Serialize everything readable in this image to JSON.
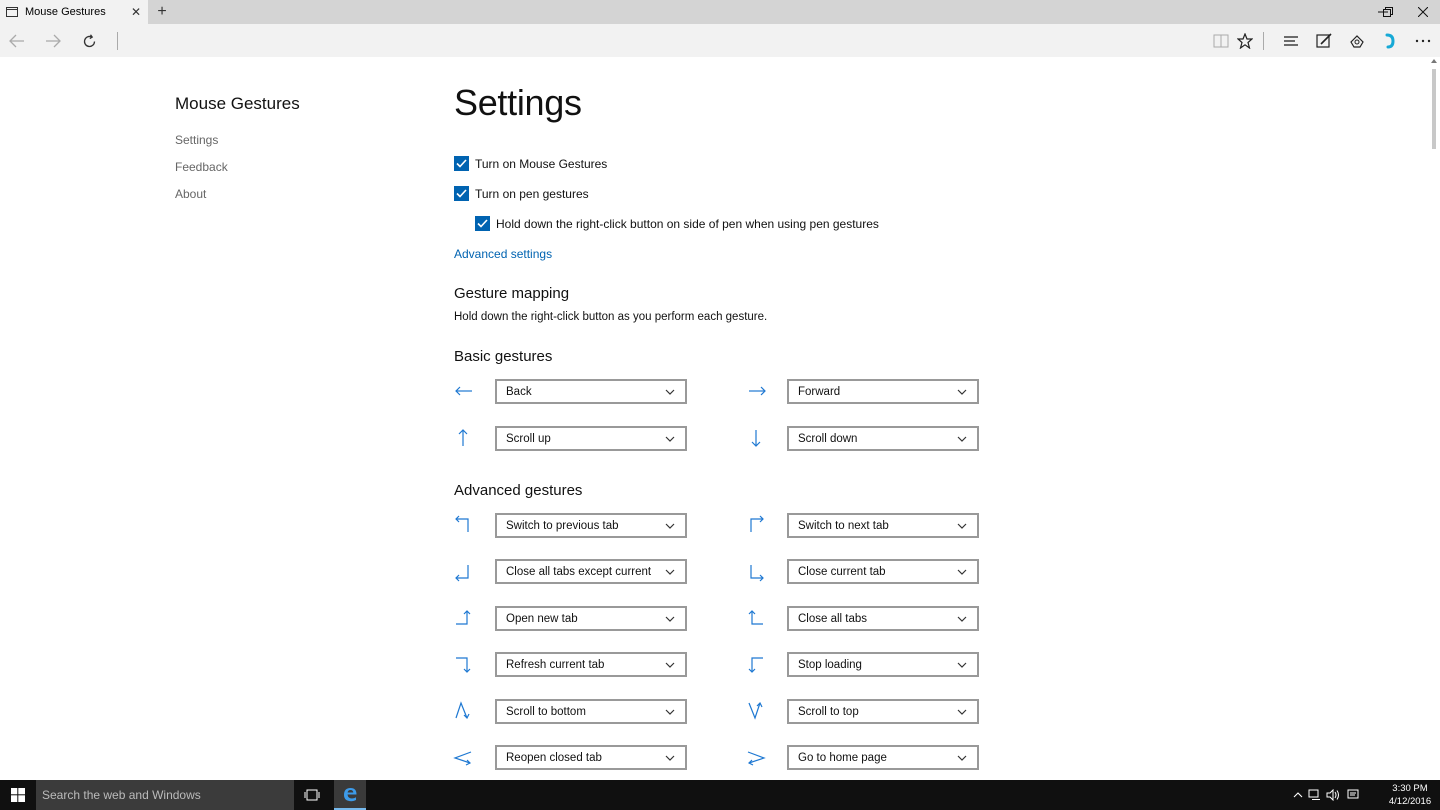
{
  "browser": {
    "tab_title": "Mouse Gestures",
    "tab_close_icon": "close-icon",
    "new_tab_icon": "plus-icon",
    "window_controls": [
      "minimize-icon",
      "restore-icon",
      "close-icon"
    ]
  },
  "sidebar": {
    "title": "Mouse Gestures",
    "items": [
      {
        "label": "Settings"
      },
      {
        "label": "Feedback"
      },
      {
        "label": "About"
      }
    ]
  },
  "main": {
    "title": "Settings",
    "options": [
      {
        "label": "Turn on Mouse Gestures",
        "checked": true
      },
      {
        "label": "Turn on pen gestures",
        "checked": true
      },
      {
        "label": "Hold down the right-click button on side of pen when using pen gestures",
        "checked": true
      }
    ],
    "advanced_link": "Advanced settings",
    "mapping_title": "Gesture mapping",
    "mapping_desc": "Hold down the right-click button as you perform each gesture.",
    "basic_title": "Basic gestures",
    "basic": [
      {
        "icon": "arrow-left-icon",
        "action": "Back"
      },
      {
        "icon": "arrow-right-icon",
        "action": "Forward"
      },
      {
        "icon": "arrow-up-icon",
        "action": "Scroll up"
      },
      {
        "icon": "arrow-down-icon",
        "action": "Scroll down"
      }
    ],
    "advanced_title": "Advanced gestures",
    "advanced": [
      {
        "icon": "up-left-gesture-icon",
        "action": "Switch to previous tab"
      },
      {
        "icon": "up-right-gesture-icon",
        "action": "Switch to next tab"
      },
      {
        "icon": "down-left-gesture-icon",
        "action": "Close all tabs except current"
      },
      {
        "icon": "down-right-gesture-icon",
        "action": "Close current tab"
      },
      {
        "icon": "right-up-gesture-icon",
        "action": "Open new tab"
      },
      {
        "icon": "left-up-gesture-icon",
        "action": "Close all tabs"
      },
      {
        "icon": "right-down-gesture-icon",
        "action": "Refresh current tab"
      },
      {
        "icon": "left-down-gesture-icon",
        "action": "Stop loading"
      },
      {
        "icon": "up-down-gesture-icon",
        "action": "Scroll to bottom"
      },
      {
        "icon": "down-up-gesture-icon",
        "action": "Scroll to top"
      },
      {
        "icon": "left-right-gesture-icon",
        "action": "Reopen closed tab"
      },
      {
        "icon": "right-left-gesture-icon",
        "action": "Go to home page"
      }
    ]
  },
  "taskbar": {
    "search_placeholder": "Search the web and Windows",
    "time": "3:30 PM",
    "date": "4/12/2016"
  },
  "colors": {
    "accent": "#0063b1",
    "icon_blue": "#1e78d2"
  }
}
